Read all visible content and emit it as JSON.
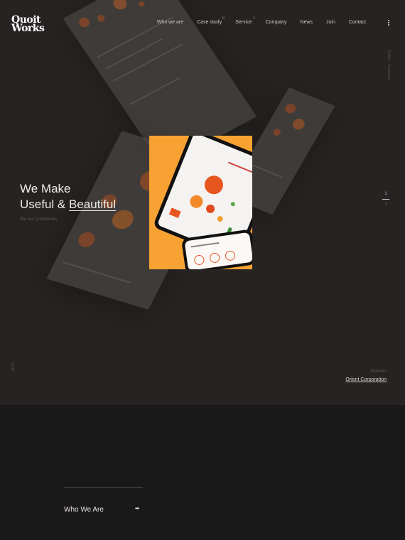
{
  "brand": {
    "logo_line1": "Quoit",
    "logo_line2": "Works"
  },
  "nav": {
    "items": [
      {
        "label": "Who we are"
      },
      {
        "label": "Case study",
        "count": "34"
      },
      {
        "label": "Service",
        "count": "4"
      },
      {
        "label": "Company"
      },
      {
        "label": "News"
      },
      {
        "label": "Join"
      },
      {
        "label": "Contact"
      }
    ]
  },
  "social": {
    "twitter": "Twitter",
    "facebook": "Facebook"
  },
  "hero": {
    "line1": "We Make",
    "line2_a": "Useful & ",
    "line2_b": "Beautiful",
    "subtitle": "We Are QuoitWorks"
  },
  "slider": {
    "current": "1",
    "total": "3"
  },
  "side_label": "Scroll",
  "partner": {
    "label": "Partners",
    "name": "Orient Corporation"
  },
  "who": {
    "title": "Who We Are",
    "more": "•••"
  },
  "colors": {
    "accent": "#f7a233",
    "bg": "#262322",
    "section_bg": "#1a1919"
  }
}
